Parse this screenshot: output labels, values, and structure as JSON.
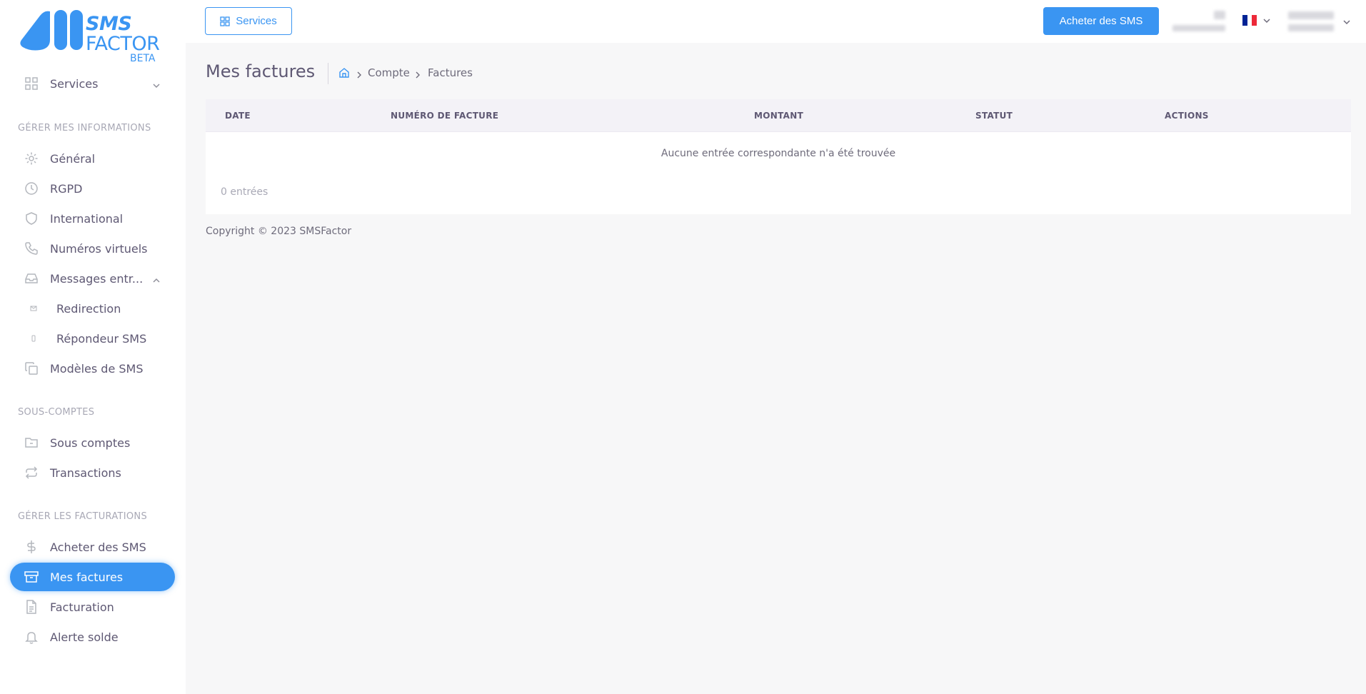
{
  "logo": {
    "line1": "SMS",
    "line2": "FACTOR",
    "line3": "BETA"
  },
  "sidebar": {
    "services": "Services",
    "sections": [
      "GÉRER MES INFORMATIONS",
      "SOUS-COMPTES",
      "GÉRER LES FACTURATIONS"
    ],
    "items": [
      {
        "label": "Général",
        "icon": "gear-icon"
      },
      {
        "label": "RGPD",
        "icon": "clock-icon"
      },
      {
        "label": "International",
        "icon": "shield-icon"
      },
      {
        "label": "Numéros virtuels",
        "icon": "phone-icon"
      },
      {
        "label": "Messages entr...",
        "icon": "inbox-icon"
      },
      {
        "label": "Redirection",
        "icon": "mail-icon"
      },
      {
        "label": "Répondeur SMS",
        "icon": "mobile-icon"
      },
      {
        "label": "Modèles de SMS",
        "icon": "copy-icon"
      },
      {
        "label": "Sous comptes",
        "icon": "folder-icon"
      },
      {
        "label": "Transactions",
        "icon": "repeat-icon"
      },
      {
        "label": "Acheter des SMS",
        "icon": "dollar-icon"
      },
      {
        "label": "Mes factures",
        "icon": "archive-icon"
      },
      {
        "label": "Facturation",
        "icon": "file-icon"
      },
      {
        "label": "Alerte solde",
        "icon": "bell-icon"
      }
    ],
    "active_color": "#3a95f2"
  },
  "topbar": {
    "services_label": "Services",
    "buy_label": "Acheter des SMS"
  },
  "page": {
    "title": "Mes factures",
    "breadcrumb": [
      "Compte",
      "Factures"
    ]
  },
  "table": {
    "columns": [
      "DATE",
      "NUMÉRO DE FACTURE",
      "MONTANT",
      "STATUT",
      "ACTIONS"
    ],
    "empty_message": "Aucune entrée correspondante n'a été trouvée",
    "count": "0 entrées"
  },
  "footer": "Copyright © 2023 SMSFactor"
}
